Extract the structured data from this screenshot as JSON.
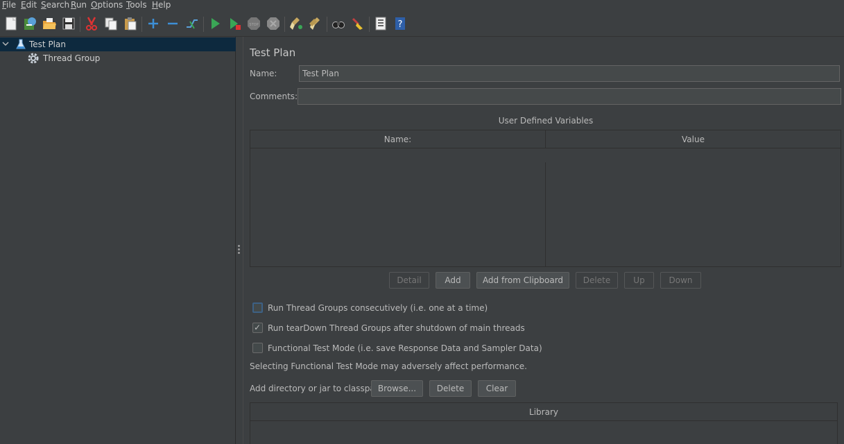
{
  "menu": [
    {
      "mnemonic": "F",
      "rest": "ile"
    },
    {
      "mnemonic": "E",
      "rest": "dit"
    },
    {
      "mnemonic": "S",
      "rest": "earch"
    },
    {
      "mnemonic": "R",
      "rest": "un"
    },
    {
      "mnemonic": "O",
      "rest": "ptions"
    },
    {
      "mnemonic": "T",
      "rest": "ools"
    },
    {
      "mnemonic": "H",
      "rest": "elp"
    }
  ],
  "toolbar_icons": [
    "new-icon",
    "templates-icon",
    "open-icon",
    "save-icon",
    "cut-icon",
    "copy-icon",
    "paste-icon",
    "expand-icon",
    "collapse-icon",
    "toggle-icon",
    "start-icon",
    "start-no-pause-icon",
    "stop-icon",
    "shutdown-icon",
    "clear-icon",
    "clear-all-icon",
    "search-icon",
    "reset-search-icon",
    "function-helper-icon",
    "help-icon"
  ],
  "tree": {
    "items": [
      {
        "label": "Test Plan",
        "icon": "flask-icon",
        "selected": true
      },
      {
        "label": "Thread Group",
        "icon": "gear-icon",
        "selected": false
      }
    ]
  },
  "main": {
    "title": "Test Plan",
    "name_label": "Name:",
    "name_value": "Test Plan",
    "comments_label": "Comments:",
    "comments_value": "",
    "udv_title": "User Defined Variables",
    "udv_columns": [
      "Name:",
      "Value"
    ],
    "udv_buttons": {
      "detail": "Detail",
      "add": "Add",
      "add_clipboard": "Add from Clipboard",
      "delete": "Delete",
      "up": "Up",
      "down": "Down"
    },
    "checkboxes": [
      {
        "label": "Run Thread Groups consecutively (i.e. one at a time)",
        "checked": false
      },
      {
        "label": "Run tearDown Thread Groups after shutdown of main threads",
        "checked": true
      },
      {
        "label": "Functional Test Mode (i.e. save Response Data and Sampler Data)",
        "checked": false
      }
    ],
    "functional_note": "Selecting Functional Test Mode may adversely affect performance.",
    "classpath_label": "Add directory or jar to classpath",
    "classpath_buttons": {
      "browse": "Browse...",
      "delete": "Delete",
      "clear": "Clear"
    },
    "library_column": "Library"
  },
  "colors": {
    "background": "#3c3f41",
    "selection": "#0d293e",
    "field": "#45494a",
    "text": "#bbbbbb",
    "accent_green": "#3aa656",
    "accent_blue": "#3d8fd6"
  }
}
